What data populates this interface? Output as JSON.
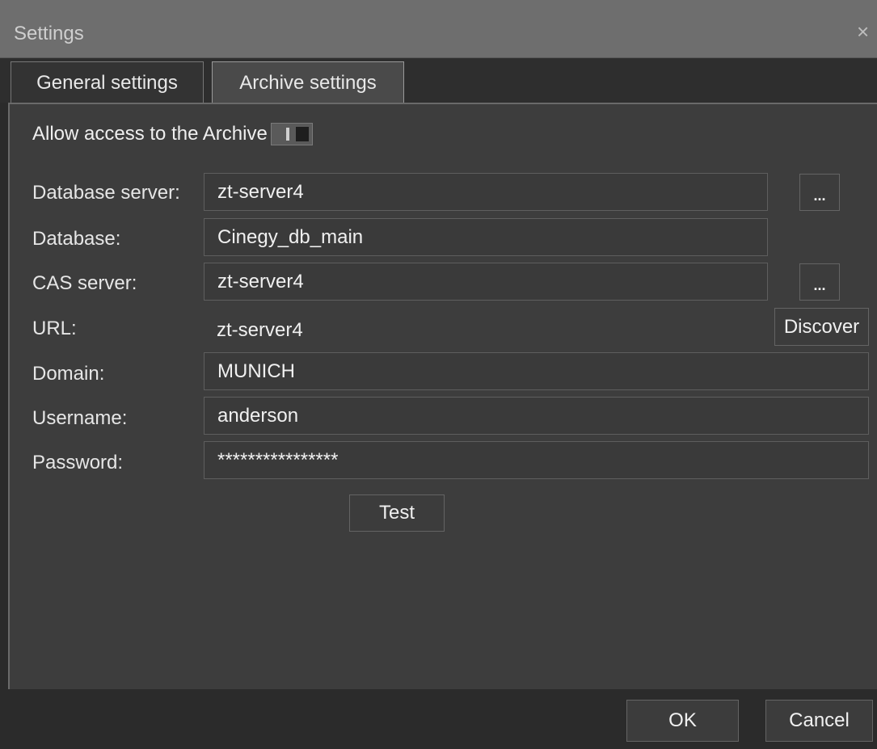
{
  "window": {
    "title": "Settings",
    "close_glyph": "×"
  },
  "tabs": [
    {
      "label": "General settings"
    },
    {
      "label": "Archive  settings"
    }
  ],
  "archive": {
    "allow_access_label": "Allow access to the Archive",
    "fields": {
      "database_server": {
        "label": "Database server:",
        "value": "zt-server4",
        "browse_label": "..."
      },
      "database": {
        "label": "Database:",
        "value": "Cinegy_db_main"
      },
      "cas_server": {
        "label": "CAS server:",
        "value": "zt-server4",
        "browse_label": "..."
      },
      "url": {
        "label": "URL:",
        "value": "zt-server4",
        "discover_label": "Discover"
      },
      "domain": {
        "label": "Domain:",
        "value": "MUNICH"
      },
      "username": {
        "label": "Username:",
        "value": "anderson"
      },
      "password": {
        "label": "Password:",
        "value": "****************"
      }
    },
    "test_label": "Test"
  },
  "footer": {
    "ok_label": "OK",
    "cancel_label": "Cancel"
  }
}
